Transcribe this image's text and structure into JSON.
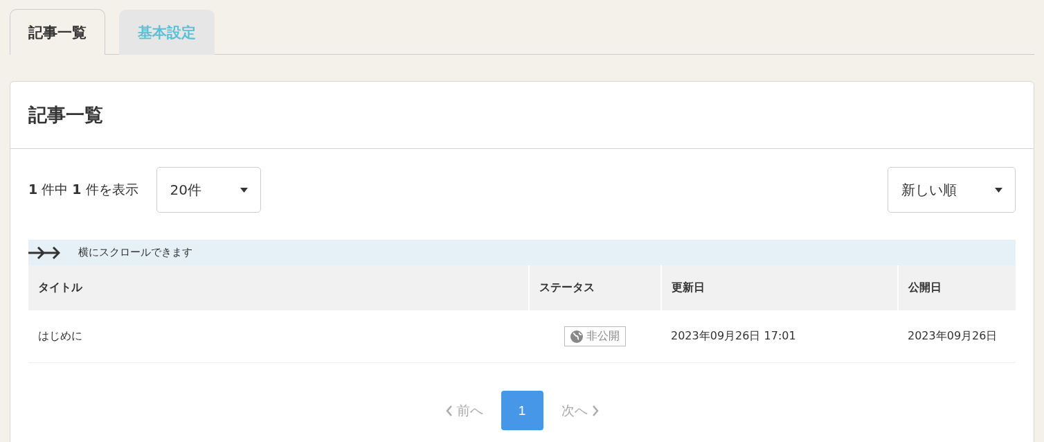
{
  "tabs": [
    {
      "label": "記事一覧",
      "selected": true
    },
    {
      "label": "基本設定",
      "selected": false
    }
  ],
  "panel": {
    "title": "記事一覧",
    "count": "**1** 件中 **1** 件を表示",
    "per_page": "20件",
    "sort": "新しい順",
    "scroll_hint": "横にスクロールできます",
    "table": {
      "columns": [
        "タイトル",
        "ステータス",
        "更新日",
        "公開日"
      ],
      "rows": [
        {
          "title": "はじめに",
          "status": "非公開",
          "updated": "2023年09月26日 17:01",
          "published": "2023年09月26日"
        }
      ]
    },
    "pagination": {
      "prev": {
        "label": "前へ",
        "disabled": true
      },
      "pages": [
        {
          "label": "1",
          "selected": true
        }
      ],
      "next": {
        "label": "次へ",
        "disabled": true
      }
    }
  }
}
